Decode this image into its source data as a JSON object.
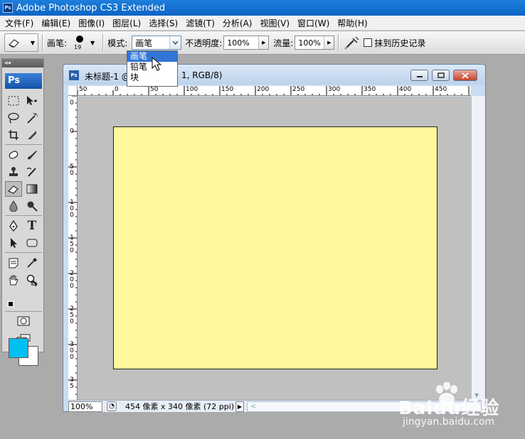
{
  "window": {
    "title": "Adobe Photoshop CS3 Extended",
    "badge": "Ps"
  },
  "menu": [
    "文件(F)",
    "编辑(E)",
    "图像(I)",
    "图层(L)",
    "选择(S)",
    "滤镜(T)",
    "分析(A)",
    "视图(V)",
    "窗口(W)",
    "帮助(H)"
  ],
  "options": {
    "brush_label": "画笔:",
    "brush_size": "19",
    "mode_label": "模式:",
    "mode_value": "画笔",
    "opacity_label": "不透明度:",
    "opacity_value": "100%",
    "flow_label": "流量:",
    "flow_value": "100%",
    "history_label": "抹到历史记录"
  },
  "mode_dropdown": {
    "options": [
      "画笔",
      "铅笔",
      "块"
    ],
    "selected_index": 0
  },
  "toolbox": {
    "collapse_label": "◂◂",
    "logo": "Ps"
  },
  "colors": {
    "foreground": "#00bff3",
    "background": "#ffffff",
    "canvas": "#fff89d",
    "titlebar": "#0b63c4"
  },
  "document": {
    "title_left": "未标题-1 @",
    "title_right": "1, RGB/8)",
    "ruler_top": [
      "50",
      "0",
      "50",
      "100",
      "150",
      "200",
      "250",
      "300",
      "350",
      "400",
      "450"
    ],
    "ruler_left": [
      "0",
      "0",
      "5\n0",
      "1\n0\n0",
      "1\n5\n0",
      "2\n0\n0",
      "2\n5\n0",
      "3\n0\n0",
      "3\n5"
    ],
    "zoom": "100%",
    "status_info": "454 像素 x 340 像素 (72 ppi)",
    "scroll_left_arrow": "<"
  },
  "watermark": {
    "brand": "Baidu经验",
    "url": "jingyan.baidu.com"
  }
}
